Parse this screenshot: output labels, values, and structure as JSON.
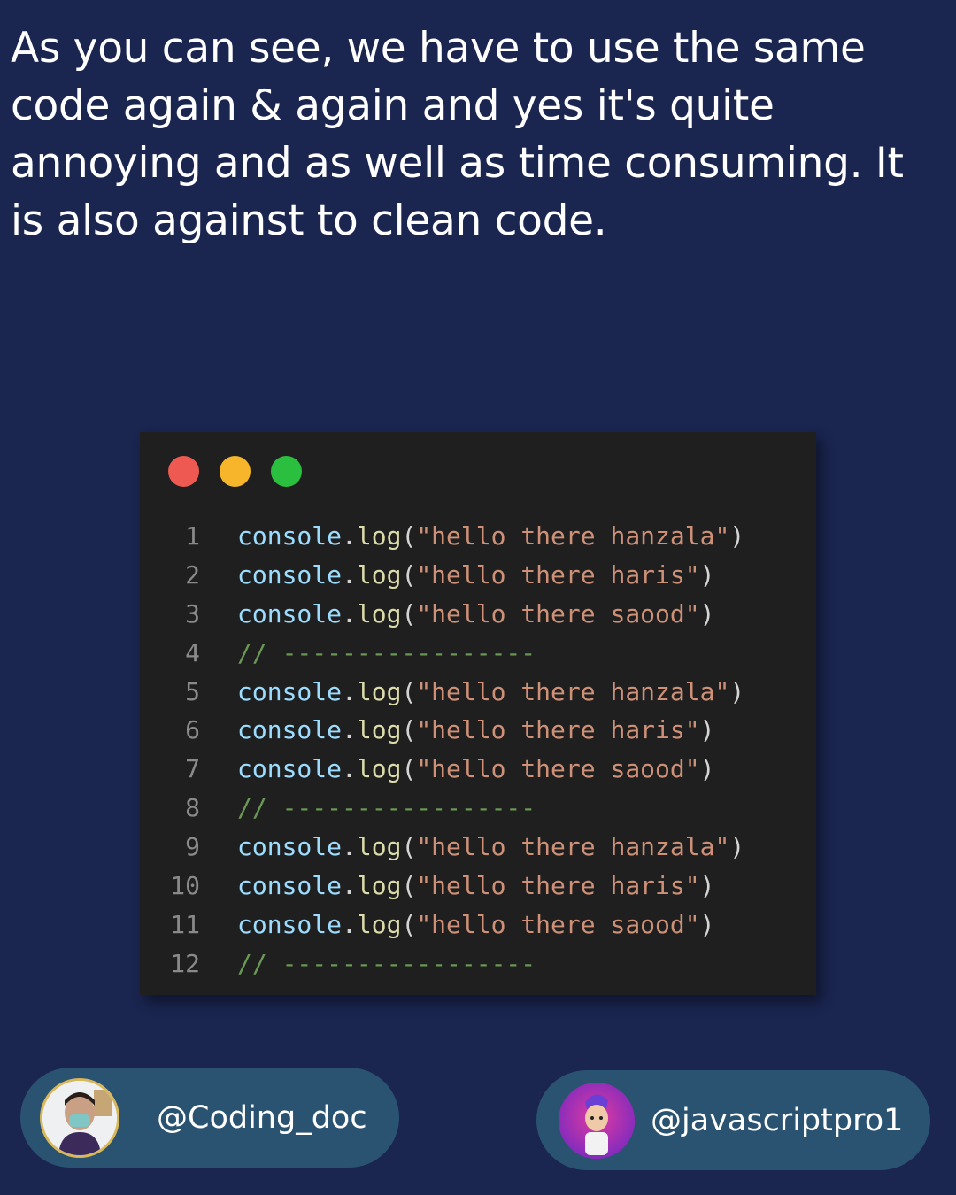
{
  "intro_text": "As you can see, we have to use the same code again & again and yes it's quite annoying and as well as time consuming. It is also against to clean code.",
  "window_controls": [
    {
      "name": "close",
      "color": "#ee5a52"
    },
    {
      "name": "minimize",
      "color": "#f7b52c"
    },
    {
      "name": "maximize",
      "color": "#2bbf3f"
    }
  ],
  "code": {
    "lines": [
      {
        "num": "1",
        "obj": "console",
        "dot": ".",
        "fn": "log",
        "open": "(",
        "str": "\"hello there hanzala\"",
        "close": ")",
        "comment": ""
      },
      {
        "num": "2",
        "obj": "console",
        "dot": ".",
        "fn": "log",
        "open": "(",
        "str": "\"hello there haris\"",
        "close": ")",
        "comment": ""
      },
      {
        "num": "3",
        "obj": "console",
        "dot": ".",
        "fn": "log",
        "open": "(",
        "str": "\"hello there saood\"",
        "close": ")",
        "comment": ""
      },
      {
        "num": "4",
        "obj": "",
        "dot": "",
        "fn": "",
        "open": "",
        "str": "",
        "close": "",
        "comment": "// -----------------"
      },
      {
        "num": "5",
        "obj": "console",
        "dot": ".",
        "fn": "log",
        "open": "(",
        "str": "\"hello there hanzala\"",
        "close": ")",
        "comment": ""
      },
      {
        "num": "6",
        "obj": "console",
        "dot": ".",
        "fn": "log",
        "open": "(",
        "str": "\"hello there haris\"",
        "close": ")",
        "comment": ""
      },
      {
        "num": "7",
        "obj": "console",
        "dot": ".",
        "fn": "log",
        "open": "(",
        "str": "\"hello there saood\"",
        "close": ")",
        "comment": ""
      },
      {
        "num": "8",
        "obj": "",
        "dot": "",
        "fn": "",
        "open": "",
        "str": "",
        "close": "",
        "comment": "// -----------------"
      },
      {
        "num": "9",
        "obj": "console",
        "dot": ".",
        "fn": "log",
        "open": "(",
        "str": "\"hello there hanzala\"",
        "close": ")",
        "comment": ""
      },
      {
        "num": "10",
        "obj": "console",
        "dot": ".",
        "fn": "log",
        "open": "(",
        "str": "\"hello there haris\"",
        "close": ")",
        "comment": ""
      },
      {
        "num": "11",
        "obj": "console",
        "dot": ".",
        "fn": "log",
        "open": "(",
        "str": "\"hello there saood\"",
        "close": ")",
        "comment": ""
      },
      {
        "num": "12",
        "obj": "",
        "dot": "",
        "fn": "",
        "open": "",
        "str": "",
        "close": "",
        "comment": "// -----------------"
      }
    ]
  },
  "footer": {
    "left_handle": "@Coding_doc",
    "right_handle": "@javascriptpro1"
  }
}
